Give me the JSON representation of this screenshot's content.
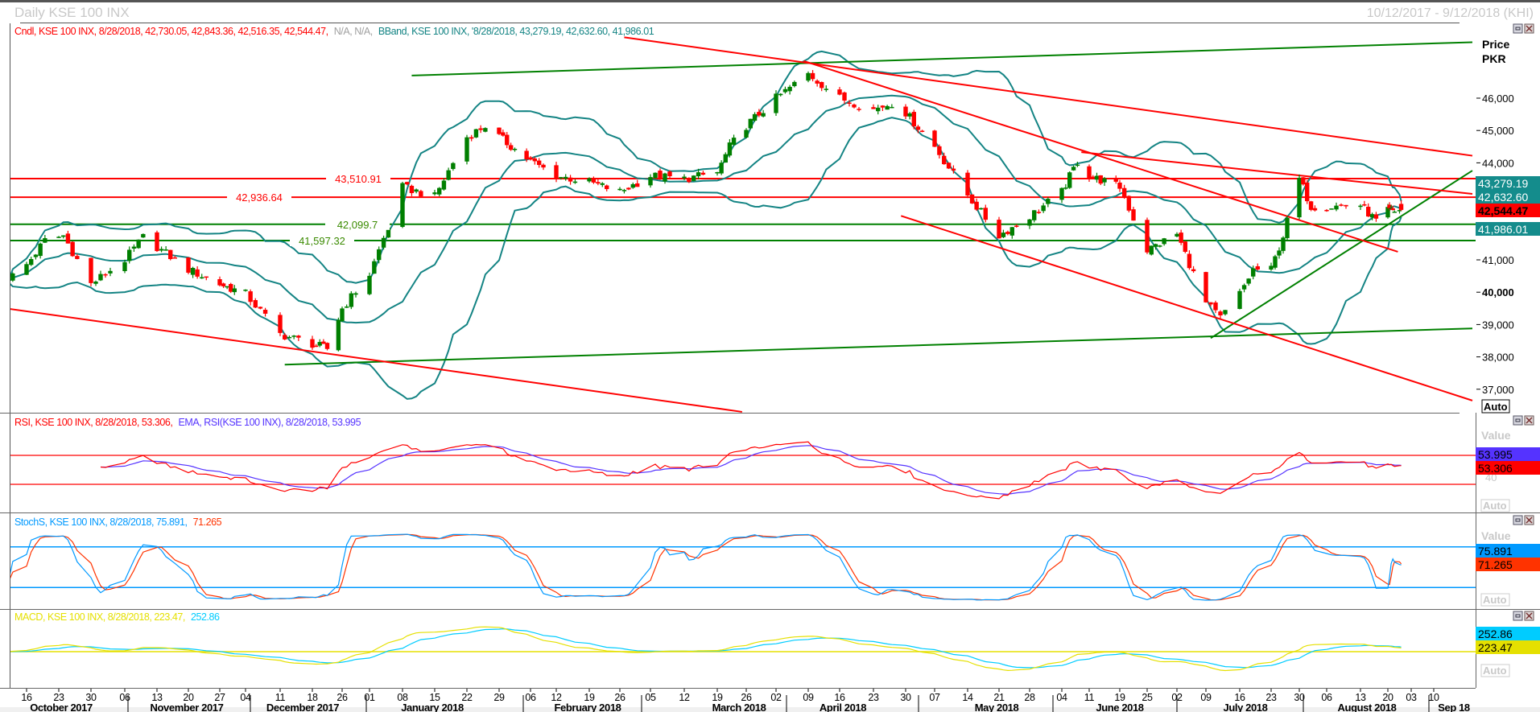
{
  "header": {
    "title": "Daily KSE 100 INX",
    "date_range": "10/12/2017 - 9/12/2018 (KHI)"
  },
  "price_panel": {
    "legend_candle": "Cndl, KSE 100 INX, 8/28/2018, 42,730.05, 42,843.36, 42,516.35, 42,544.47,",
    "legend_na": "N/A, N/A,",
    "legend_bband": "BBand, KSE 100 INX, '8/28/2018, 43,279.19, 42,632.60, 41,986.01",
    "axis_title": "Price",
    "axis_unit": "PKR",
    "scale_mode": "Auto",
    "value_boxes": [
      {
        "label": "43,279.19",
        "bg": "#148c8c",
        "fg": "#ffffff",
        "bold": false
      },
      {
        "label": "42,632.60",
        "bg": "#148c8c",
        "fg": "#ffffff",
        "bold": false
      },
      {
        "label": "42,544.47",
        "bg": "#ff0000",
        "fg": "#000000",
        "bold": true
      },
      {
        "label": "41,986.01",
        "bg": "#148c8c",
        "fg": "#ffffff",
        "bold": false
      }
    ]
  },
  "rsi_panel": {
    "legend_rsi": "RSI, KSE 100 INX, 8/28/2018, 53.306,",
    "legend_ema": "EMA, RSI(KSE 100 INX), 8/28/2018, 53.995",
    "value_header": "Value",
    "tick_label": "40",
    "scale_mode": "Auto",
    "value_boxes": [
      {
        "label": "53.995",
        "bg": "#5533ff",
        "fg": "#000000"
      },
      {
        "label": "53.306",
        "bg": "#ff0000",
        "fg": "#000000"
      }
    ]
  },
  "stoch_panel": {
    "legend_k": "StochS, KSE 100 INX, 8/28/2018, 75.891,",
    "legend_d": "71.265",
    "value_header": "Value",
    "scale_mode": "Auto",
    "value_boxes": [
      {
        "label": "75.891",
        "bg": "#0099ff",
        "fg": "#000000"
      },
      {
        "label": "71.265",
        "bg": "#ff3300",
        "fg": "#000000"
      }
    ]
  },
  "macd_panel": {
    "legend_macd": "MACD, KSE 100 INX, 8/28/2018, 223.47,",
    "legend_signal": "252.86",
    "scale_mode": "Auto",
    "value_boxes": [
      {
        "label": "252.86",
        "bg": "#00ccff",
        "fg": "#000000"
      },
      {
        "label": "223.47",
        "bg": "#e5e000",
        "fg": "#000000"
      }
    ]
  },
  "colors": {
    "up_candle": "#007f00",
    "down_candle": "#ff0000",
    "bollinger": "#148484",
    "rsi": "#ff0000",
    "rsi_ema": "#5533ff",
    "stoch_k": "#0099ff",
    "stoch_d": "#ff3300",
    "macd": "#e5e000",
    "macd_signal": "#00ccff"
  },
  "chart_data": {
    "type": "candlestick",
    "instrument": "KSE 100 INX",
    "interval": "Daily",
    "price_axis": {
      "ticks": [
        "46,000",
        "45,000",
        "44,000",
        "41,000",
        "40,000",
        "39,000",
        "38,000",
        "37,000"
      ],
      "tick_values": [
        46000,
        45000,
        44000,
        41000,
        40000,
        39000,
        38000,
        37000
      ],
      "bold_tick": "40,000",
      "range": [
        36700,
        48000
      ]
    },
    "last_candle": {
      "date": "2018-08-28",
      "open": 42730.05,
      "high": 42843.36,
      "low": 42516.35,
      "close": 42544.47
    },
    "close_anchors": [
      [
        "2017-10-12",
        40400
      ],
      [
        "2017-10-16",
        40850
      ],
      [
        "2017-10-20",
        41600
      ],
      [
        "2017-10-24",
        41750
      ],
      [
        "2017-10-30",
        40250
      ],
      [
        "2017-11-06",
        41000
      ],
      [
        "2017-11-10",
        41700
      ],
      [
        "2017-11-20",
        40700
      ],
      [
        "2017-11-27",
        40250
      ],
      [
        "2017-12-04",
        39950
      ],
      [
        "2017-12-11",
        38700
      ],
      [
        "2017-12-18",
        38400
      ],
      [
        "2017-12-22",
        38250
      ],
      [
        "2017-12-26",
        39500
      ],
      [
        "2018-01-01",
        40550
      ],
      [
        "2018-01-05",
        42050
      ],
      [
        "2018-01-08",
        43250
      ],
      [
        "2018-01-15",
        42950
      ],
      [
        "2018-01-22",
        44800
      ],
      [
        "2018-01-26",
        45150
      ],
      [
        "2018-01-29",
        44800
      ],
      [
        "2018-02-06",
        44050
      ],
      [
        "2018-02-12",
        43600
      ],
      [
        "2018-02-19",
        43400
      ],
      [
        "2018-02-26",
        43100
      ],
      [
        "2018-03-05",
        43600
      ],
      [
        "2018-03-12",
        43500
      ],
      [
        "2018-03-19",
        43700
      ],
      [
        "2018-03-22",
        44500
      ],
      [
        "2018-03-26",
        45150
      ],
      [
        "2018-04-02",
        46000
      ],
      [
        "2018-04-09",
        46750
      ],
      [
        "2018-04-16",
        46000
      ],
      [
        "2018-04-23",
        45650
      ],
      [
        "2018-04-27",
        45850
      ],
      [
        "2018-04-30",
        45550
      ],
      [
        "2018-05-07",
        44500
      ],
      [
        "2018-05-14",
        43000
      ],
      [
        "2018-05-21",
        41750
      ],
      [
        "2018-05-28",
        42350
      ],
      [
        "2018-06-04",
        43100
      ],
      [
        "2018-06-08",
        44050
      ],
      [
        "2018-06-11",
        43600
      ],
      [
        "2018-06-19",
        43250
      ],
      [
        "2018-06-25",
        41300
      ],
      [
        "2018-07-02",
        41800
      ],
      [
        "2018-07-09",
        39650
      ],
      [
        "2018-07-12",
        39200
      ],
      [
        "2018-07-16",
        39950
      ],
      [
        "2018-07-19",
        40700
      ],
      [
        "2018-07-23",
        40700
      ],
      [
        "2018-07-26",
        41750
      ],
      [
        "2018-07-30",
        43500
      ],
      [
        "2018-08-02",
        42650
      ],
      [
        "2018-08-06",
        42650
      ],
      [
        "2018-08-13",
        42700
      ],
      [
        "2018-08-17",
        42200
      ],
      [
        "2018-08-20",
        42500
      ],
      [
        "2018-08-28",
        42544.47
      ]
    ],
    "bollinger_last": {
      "upper": 43279.19,
      "middle": 42632.6,
      "lower": 41986.01
    },
    "levels": [
      {
        "label": "43,510.91",
        "value": 43510.91,
        "color": "#ff0000"
      },
      {
        "label": "42,936.64",
        "value": 42936.64,
        "color": "#ff0000"
      },
      {
        "label": "42,099.7",
        "value": 42099.7,
        "color": "#008000"
      },
      {
        "label": "41,597.32",
        "value": 41597.32,
        "color": "#008000"
      }
    ],
    "trendlines": [
      {
        "color": "#008000",
        "from": [
          "2018-01-10",
          46700
        ],
        "to": [
          "2018-09-22",
          47730
        ]
      },
      {
        "color": "#008000",
        "from": [
          "2017-12-12",
          37760
        ],
        "to": [
          "2018-09-22",
          38880
        ]
      },
      {
        "color": "#008000",
        "from": [
          "2018-07-10",
          38580
        ],
        "to": [
          "2018-09-22",
          43760
        ]
      },
      {
        "color": "#ff0000",
        "from": [
          "2017-10-12",
          39490
        ],
        "to": [
          "2018-03-25",
          36300
        ]
      },
      {
        "color": "#ff0000",
        "from": [
          "2018-02-27",
          47880
        ],
        "to": [
          "2018-09-22",
          44220
        ]
      },
      {
        "color": "#ff0000",
        "from": [
          "2018-04-08",
          47150
        ],
        "to": [
          "2018-08-26",
          41250
        ]
      },
      {
        "color": "#ff0000",
        "from": [
          "2018-06-09",
          44330
        ],
        "to": [
          "2018-09-22",
          43040
        ]
      },
      {
        "color": "#ff0000",
        "from": [
          "2018-04-29",
          42360
        ],
        "to": [
          "2018-09-22",
          36650
        ]
      }
    ],
    "rsi": {
      "last": 53.306,
      "ema_last": 53.995,
      "bands": [
        70,
        30
      ]
    },
    "stoch": {
      "k_last": 75.891,
      "d_last": 71.265,
      "bands": [
        80,
        20
      ]
    },
    "macd": {
      "macd_last": 223.47,
      "signal_last": 252.86
    },
    "x_axis": {
      "day_ticks": [
        [
          "2017-10-16",
          "16"
        ],
        [
          "2017-10-23",
          "23"
        ],
        [
          "2017-10-30",
          "30"
        ],
        [
          "2017-11-06",
          "06"
        ],
        [
          "2017-11-13",
          "13"
        ],
        [
          "2017-11-20",
          "20"
        ],
        [
          "2017-11-27",
          "27"
        ],
        [
          "2017-12-04",
          "04"
        ],
        [
          "2017-12-11",
          "11"
        ],
        [
          "2017-12-18",
          "18"
        ],
        [
          "2017-12-26",
          "26"
        ],
        [
          "2018-01-01",
          "01"
        ],
        [
          "2018-01-08",
          "08"
        ],
        [
          "2018-01-15",
          "15"
        ],
        [
          "2018-01-22",
          "22"
        ],
        [
          "2018-01-29",
          "29"
        ],
        [
          "2018-02-06",
          "06"
        ],
        [
          "2018-02-12",
          "12"
        ],
        [
          "2018-02-19",
          "19"
        ],
        [
          "2018-02-26",
          "26"
        ],
        [
          "2018-03-05",
          "05"
        ],
        [
          "2018-03-12",
          "12"
        ],
        [
          "2018-03-19",
          "19"
        ],
        [
          "2018-03-26",
          "26"
        ],
        [
          "2018-04-02",
          "02"
        ],
        [
          "2018-04-09",
          "09"
        ],
        [
          "2018-04-16",
          "16"
        ],
        [
          "2018-04-23",
          "23"
        ],
        [
          "2018-04-30",
          "30"
        ],
        [
          "2018-05-07",
          "07"
        ],
        [
          "2018-05-14",
          "14"
        ],
        [
          "2018-05-21",
          "21"
        ],
        [
          "2018-05-28",
          "28"
        ],
        [
          "2018-06-04",
          "04"
        ],
        [
          "2018-06-11",
          "11"
        ],
        [
          "2018-06-19",
          "19"
        ],
        [
          "2018-06-25",
          "25"
        ],
        [
          "2018-07-02",
          "02"
        ],
        [
          "2018-07-09",
          "09"
        ],
        [
          "2018-07-16",
          "16"
        ],
        [
          "2018-07-23",
          "23"
        ],
        [
          "2018-07-30",
          "30"
        ],
        [
          "2018-08-06",
          "06"
        ],
        [
          "2018-08-13",
          "13"
        ],
        [
          "2018-08-20",
          "20"
        ],
        [
          "2018-09-03",
          "03"
        ],
        [
          "2018-09-10",
          "10"
        ]
      ],
      "months": [
        "October 2017",
        "November 2017",
        "December 2017",
        "January 2018",
        "February 2018",
        "March 2018",
        "April 2018",
        "May 2018",
        "June 2018",
        "July 2018",
        "August 2018",
        "Sep 18"
      ]
    }
  }
}
